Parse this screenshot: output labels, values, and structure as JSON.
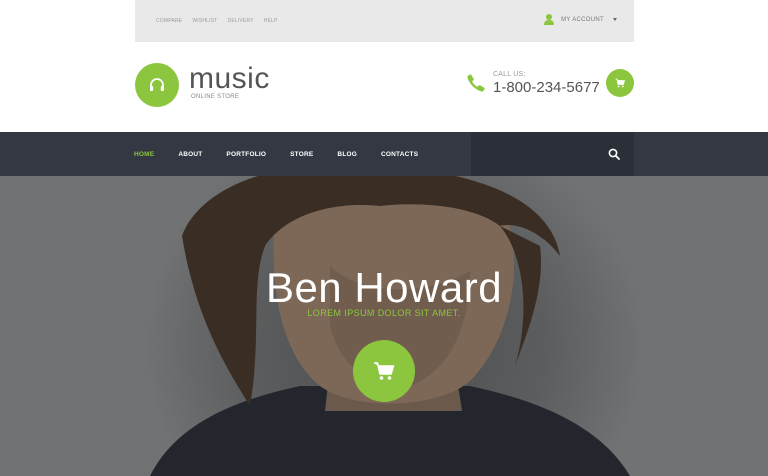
{
  "colors": {
    "accent": "#8cc63f",
    "nav_bg": "#333842",
    "topbar_bg": "#e9e9e9"
  },
  "topbar": {
    "links": [
      "Compare",
      "Wishlist",
      "Delivery",
      "Help"
    ],
    "account_label": "MY ACCOUNT",
    "account_icon": "user-icon"
  },
  "header": {
    "logo_icon": "headphones-icon",
    "logo_title": "music",
    "logo_subtitle": "ONLINE STORE",
    "call_label": "CALL US:",
    "phone": "1-800-234-5677",
    "phone_icon": "phone-icon",
    "cart_icon": "cart-icon"
  },
  "nav": {
    "items": [
      "HOME",
      "ABOUT",
      "PORTFOLIO",
      "STORE",
      "BLOG",
      "CONTACTS"
    ],
    "active": "HOME",
    "search_icon": "search-icon"
  },
  "hero": {
    "title": "Ben Howard",
    "subtitle": "LOREM IPSUM DOLOR SIT AMET.",
    "cart_icon": "cart-icon"
  }
}
